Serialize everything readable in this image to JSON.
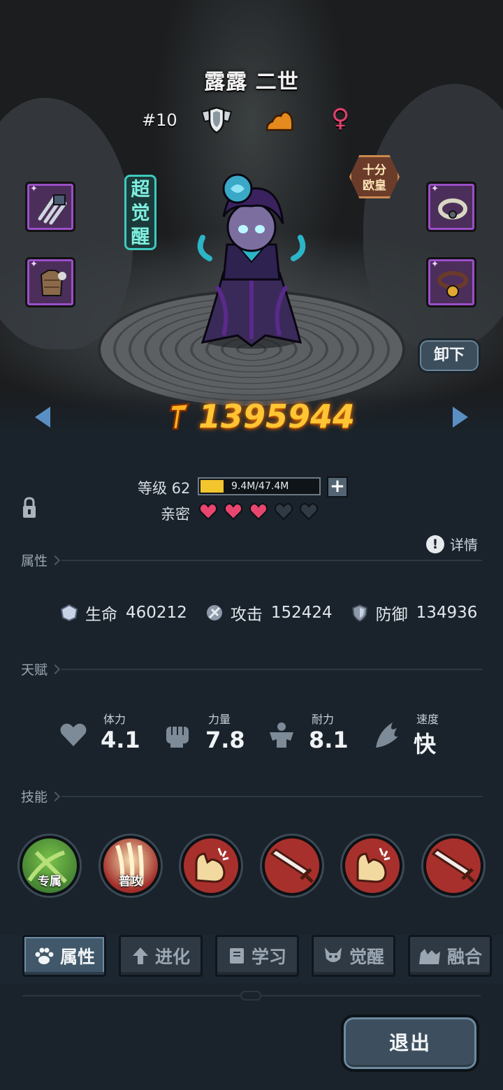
{
  "hero": {
    "name": "露露 二世",
    "rank": "#10",
    "gender_symbol": "♀",
    "awaken_tag": "超觉醒",
    "luck_tag_line1": "十分",
    "luck_tag_line2": "欧皇",
    "power": "1395944"
  },
  "icons": {
    "class": "shield-wings-icon",
    "terrain": "mountain-icon",
    "gender": "female-icon",
    "power": "power-icon"
  },
  "equipment": {
    "left": [
      "claw-weapon",
      "leather-armor"
    ],
    "right": [
      "ring-accessory",
      "bell-collar"
    ],
    "star_symbol": "✦"
  },
  "buttons": {
    "unequip": "卸下",
    "exit": "退出",
    "exp_plus": "+"
  },
  "progress": {
    "level_label": "等级 62",
    "exp_text": "9.4M/47.4M",
    "exp_fraction": 0.198,
    "intimacy_label": "亲密",
    "hearts_filled": 3,
    "hearts_total": 5
  },
  "detail": {
    "icon": "!",
    "label": "详情"
  },
  "sections": {
    "attributes": "属性",
    "talents": "天赋",
    "skills": "技能"
  },
  "stats": [
    {
      "label": "生命",
      "value": "460212"
    },
    {
      "label": "攻击",
      "value": "152424"
    },
    {
      "label": "防御",
      "value": "134936"
    }
  ],
  "talents": [
    {
      "label": "体力",
      "value": "4.1"
    },
    {
      "label": "力量",
      "value": "7.8"
    },
    {
      "label": "耐力",
      "value": "8.1"
    },
    {
      "label": "速度",
      "value": "快"
    }
  ],
  "skills": [
    {
      "caption": "专属"
    },
    {
      "caption": "普攻"
    },
    {
      "caption": ""
    },
    {
      "caption": ""
    },
    {
      "caption": ""
    },
    {
      "caption": ""
    }
  ],
  "tabs": [
    {
      "label": "属性"
    },
    {
      "label": "进化"
    },
    {
      "label": "学习"
    },
    {
      "label": "觉醒"
    },
    {
      "label": "融合"
    }
  ],
  "colors": {
    "accent_gold": "#ffc534",
    "heart_on": "#e8456f",
    "heart_off": "#2f3a44",
    "panel_bg": "#1a232c"
  }
}
